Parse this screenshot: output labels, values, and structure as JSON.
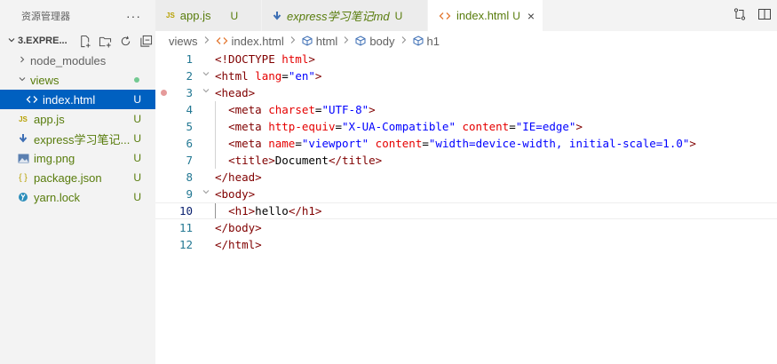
{
  "sidebar": {
    "title": "资源管理器",
    "more": "···",
    "folder_name": "3.EXPRE...",
    "items": [
      {
        "label": "node_modules",
        "status": ""
      },
      {
        "label": "views",
        "status": ""
      },
      {
        "label": "index.html",
        "status": "U"
      },
      {
        "label": "app.js",
        "status": "U",
        "icon_text": "JS"
      },
      {
        "label": "express学习笔记...",
        "status": "U"
      },
      {
        "label": "img.png",
        "status": "U"
      },
      {
        "label": "package.json",
        "status": "U",
        "icon_text": "{ }"
      },
      {
        "label": "yarn.lock",
        "status": "U"
      }
    ]
  },
  "tabs": [
    {
      "label": "app.js",
      "status": "U",
      "icon_text": "JS"
    },
    {
      "label": "express学习笔记md",
      "status": "U"
    },
    {
      "label": "index.html",
      "status": "U",
      "close": "×"
    }
  ],
  "breadcrumb": [
    "views",
    "index.html",
    "html",
    "body",
    "h1"
  ],
  "editor": {
    "current_line": 10,
    "lines": [
      {
        "n": "1"
      },
      {
        "n": "2"
      },
      {
        "n": "3"
      },
      {
        "n": "4"
      },
      {
        "n": "5"
      },
      {
        "n": "6"
      },
      {
        "n": "7"
      },
      {
        "n": "8"
      },
      {
        "n": "9"
      },
      {
        "n": "10"
      },
      {
        "n": "11"
      },
      {
        "n": "12"
      }
    ],
    "tokens": {
      "l1": [
        "<!DOCTYPE",
        " html",
        ">"
      ],
      "l2": [
        "<html",
        " lang",
        "=",
        "\"en\"",
        ">"
      ],
      "l3": [
        "<head>"
      ],
      "l4": [
        "<meta",
        " charset",
        "=",
        "\"UTF-8\"",
        ">"
      ],
      "l5": [
        "<meta",
        " http-equiv",
        "=",
        "\"X-UA-Compatible\"",
        " content",
        "=",
        "\"IE=edge\"",
        ">"
      ],
      "l6": [
        "<meta",
        " name",
        "=",
        "\"viewport\"",
        " content",
        "=",
        "\"width=device-width, initial-scale=1.0\"",
        ">"
      ],
      "l7": [
        "<title>",
        "Document",
        "</title>"
      ],
      "l8": [
        "</head>"
      ],
      "l9": [
        "<body>"
      ],
      "l10": [
        "<h1>",
        "hello",
        "</h1>"
      ],
      "l11": [
        "</body>"
      ],
      "l12": [
        "</html>"
      ]
    }
  },
  "colors": {
    "sidebar_bg": "#f3f3f3",
    "selected_bg": "#0060c0",
    "untracked": "#587c0c",
    "line_number": "#237893",
    "tag": "#800000",
    "attribute": "#e50000",
    "string": "#0000ff"
  }
}
